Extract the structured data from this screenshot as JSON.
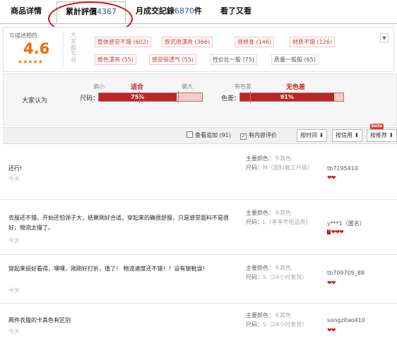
{
  "tabs": [
    {
      "label": "商品详情",
      "count": "",
      "suffix": ""
    },
    {
      "label": "累計評價",
      "count": "4367",
      "suffix": ""
    },
    {
      "label": "月成交記錄",
      "count": "6870",
      "suffix": "件"
    },
    {
      "label": "看了又看",
      "count": "",
      "suffix": ""
    }
  ],
  "rating": {
    "label": "与描述相符",
    "score": "4.6",
    "stars": "★★★★★",
    "side_label": "大家都写到",
    "tags": [
      {
        "text": "整体感觉不错",
        "count": "(602)"
      },
      {
        "text": "款式很漂亮",
        "count": "(366)"
      },
      {
        "text": "很修身",
        "count": "(146)"
      },
      {
        "text": "材质不错",
        "count": "(126)"
      },
      {
        "text": "颜色漂亮",
        "count": "(55)"
      },
      {
        "text": "感觉挺透气",
        "count": "(55)"
      },
      {
        "text": "性价比一般",
        "count": "(75)"
      },
      {
        "text": "质量一般般",
        "count": "(65)"
      }
    ],
    "more_icon": "chevron-down-icon"
  },
  "opinion": {
    "label": "大家认为",
    "size": {
      "name": "尺码：",
      "left": "偏小",
      "mid": "适合",
      "right": "偏大",
      "percent": "75%",
      "fill_fraction": 0.75
    },
    "color": {
      "name": "色差：",
      "left": "有色差",
      "mid": "无色差",
      "percent": "91%",
      "fill_fraction": 0.91
    }
  },
  "filter": {
    "append_label": "查看追加",
    "append_count": "(91)",
    "content_label": "有内容评价",
    "sort_time": "按时间",
    "sort_credit": "按信用",
    "sort_recommend": "按推荐",
    "beta": "beta",
    "arrow": "⬇"
  },
  "reviews": [
    {
      "text": "还行!",
      "date": "今天",
      "color_label": "主要颜色：",
      "color_val": "卡其色",
      "size_label": "尺码：",
      "size_val": "M（面料做工升级）",
      "user": "tb7195410",
      "hearts": "❤❤"
    },
    {
      "text": "衣服还不错，开始还怕领子大，结果刚好合适，穿起来的确很舒服，只是感觉面料不是很好，物流太慢了。",
      "date": "今天",
      "color_label": "主要颜色：",
      "color_val": "卡其色",
      "size_label": "尺码：",
      "size_val": "L（享享专柜品质）",
      "user": "y***1（匿名）",
      "hearts": "❤❤❤"
    },
    {
      "text": "穿起来挺好看得，嘿嘿，刚刚好打折，值了！ 物流速度还不错！！设有铍靴误！",
      "date": "今天",
      "color_label": "主要颜色：",
      "color_val": "卡其色",
      "size_label": "尺码：",
      "size_val": "S（24小时发货）",
      "user": "tb709709_88",
      "hearts": "❤❤"
    },
    {
      "text": "两件衣服的卡其色有区别",
      "date": "今天",
      "color_label": "主要颜色：",
      "color_val": "卡其色",
      "size_label": "尺码：",
      "size_val": "S（24小时发货）",
      "user": "songzitao410",
      "hearts": "❤❤"
    }
  ]
}
